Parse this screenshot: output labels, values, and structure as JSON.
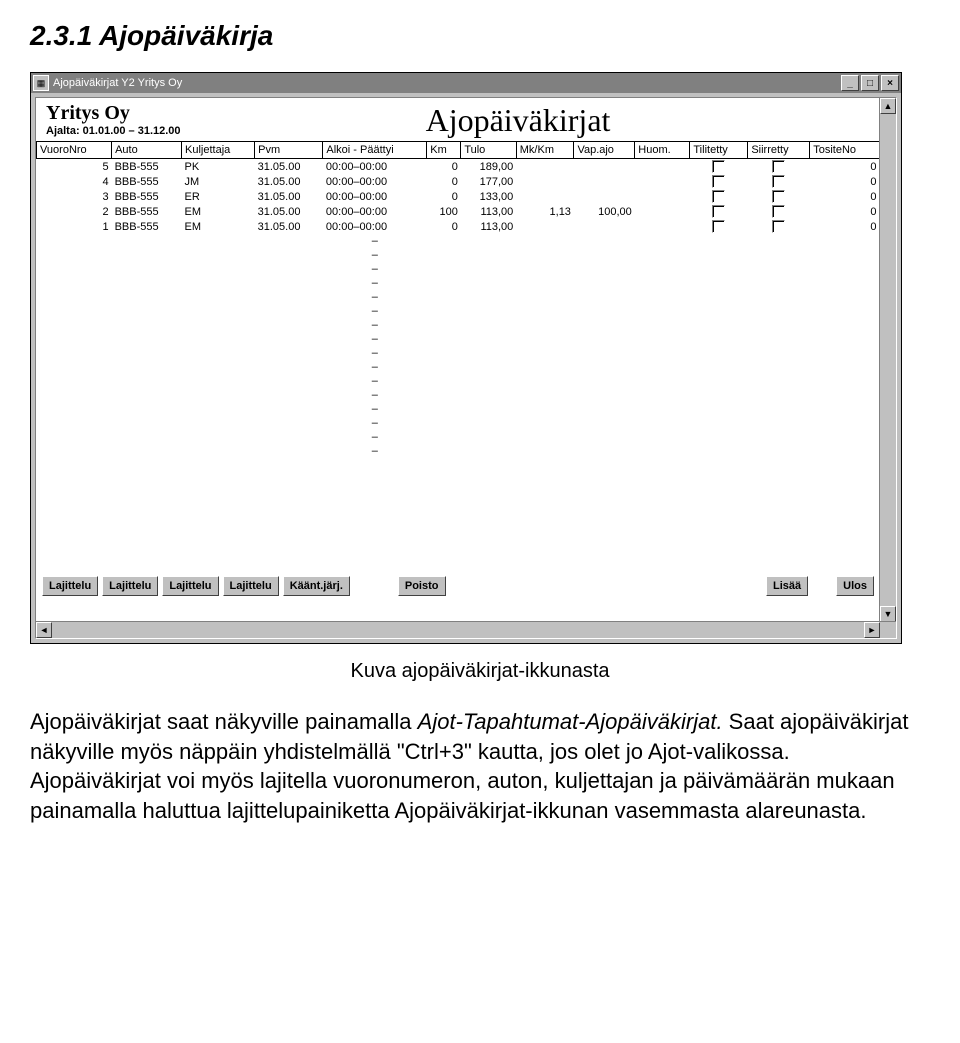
{
  "heading": "2.3.1  Ajopäiväkirja",
  "window": {
    "title": "Ajopäiväkirjat  Y2  Yritys Oy",
    "minimize": "_",
    "maximize": "□",
    "close": "×"
  },
  "doc": {
    "company": "Yritys Oy",
    "range_label": "Ajalta: 01.01.00 – 31.12.00",
    "title": "Ajopäiväkirjat"
  },
  "columns": [
    "VuoroNro",
    "Auto",
    "Kuljettaja",
    "Pvm",
    "Alkoi - Päättyi",
    "Km",
    "Tulo",
    "Mk/Km",
    "Vap.ajo",
    "Huom.",
    "Tilitetty",
    "Siirretty",
    "TositeNo"
  ],
  "rows": [
    {
      "nro": "5",
      "auto": "BBB-555",
      "kulj": "PK",
      "pvm": "31.05.00",
      "aika": "00:00–00:00",
      "km": "0",
      "tulo": "189,00",
      "mkkm": "",
      "vap": "",
      "huom": "",
      "tos": "0"
    },
    {
      "nro": "4",
      "auto": "BBB-555",
      "kulj": "JM",
      "pvm": "31.05.00",
      "aika": "00:00–00:00",
      "km": "0",
      "tulo": "177,00",
      "mkkm": "",
      "vap": "",
      "huom": "",
      "tos": "0"
    },
    {
      "nro": "3",
      "auto": "BBB-555",
      "kulj": "ER",
      "pvm": "31.05.00",
      "aika": "00:00–00:00",
      "km": "0",
      "tulo": "133,00",
      "mkkm": "",
      "vap": "",
      "huom": "",
      "tos": "0"
    },
    {
      "nro": "2",
      "auto": "BBB-555",
      "kulj": "EM",
      "pvm": "31.05.00",
      "aika": "00:00–00:00",
      "km": "100",
      "tulo": "113,00",
      "mkkm": "1,13",
      "vap": "100,00",
      "huom": "",
      "tos": "0"
    },
    {
      "nro": "1",
      "auto": "BBB-555",
      "kulj": "EM",
      "pvm": "31.05.00",
      "aika": "00:00–00:00",
      "km": "0",
      "tulo": "113,00",
      "mkkm": "",
      "vap": "",
      "huom": "",
      "tos": "0"
    }
  ],
  "empty_dash": "–",
  "buttons": {
    "sort1": "Lajittelu",
    "sort2": "Lajittelu",
    "sort3": "Lajittelu",
    "sort4": "Lajittelu",
    "reverse": "Käänt.järj.",
    "delete": "Poisto",
    "add": "Lisää",
    "exit": "Ulos"
  },
  "caption": "Kuva ajopäiväkirjat-ikkunasta",
  "para1a": "Ajopäiväkirjat saat näkyville painamalla ",
  "para1b": "Ajot-Tapahtumat-Ajopäiväkirjat.",
  "para1c": " Saat ajopäiväkirjat näkyville myös näppäin yhdistelmällä \"Ctrl+3\" kautta, jos olet jo Ajot-valikossa.",
  "para2": "Ajopäiväkirjat voi myös lajitella vuoronumeron, auton, kuljettajan ja päivämäärän mukaan painamalla haluttua lajittelupainiketta Ajopäiväkirjat-ikkunan vasemmasta alareunasta."
}
